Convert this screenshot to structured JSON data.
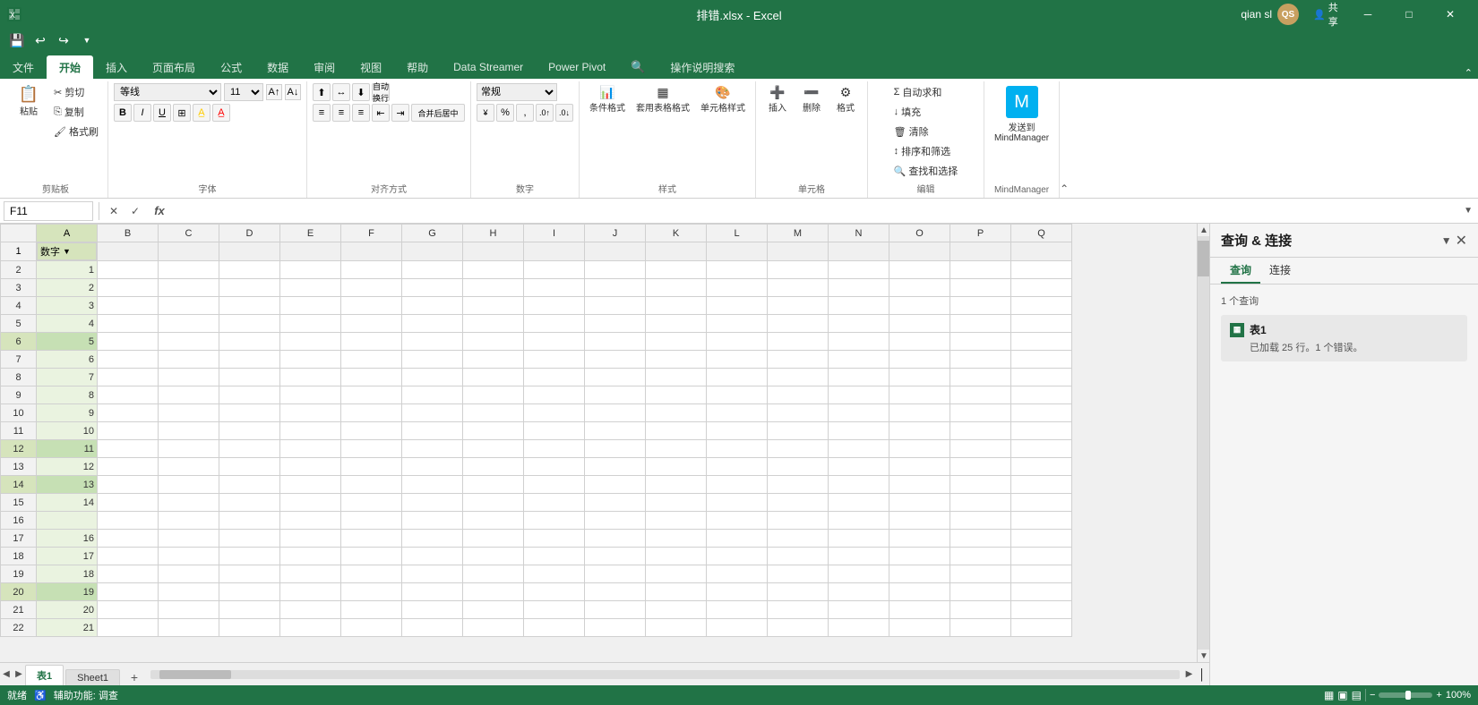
{
  "titlebar": {
    "filename": "排错.xlsx - Excel",
    "username": "qian sl",
    "avatar_text": "QS",
    "minimize": "─",
    "maximize": "□",
    "close": "✕"
  },
  "ribbon": {
    "tabs": [
      {
        "id": "file",
        "label": "文件",
        "active": false
      },
      {
        "id": "home",
        "label": "开始",
        "active": true
      },
      {
        "id": "insert",
        "label": "插入",
        "active": false
      },
      {
        "id": "layout",
        "label": "页面布局",
        "active": false
      },
      {
        "id": "formulas",
        "label": "公式",
        "active": false
      },
      {
        "id": "data",
        "label": "数据",
        "active": false
      },
      {
        "id": "review",
        "label": "审阅",
        "active": false
      },
      {
        "id": "view",
        "label": "视图",
        "active": false
      },
      {
        "id": "help",
        "label": "帮助",
        "active": false
      },
      {
        "id": "datastreamer",
        "label": "Data Streamer",
        "active": false
      },
      {
        "id": "powerpivot",
        "label": "Power Pivot",
        "active": false
      },
      {
        "id": "search_icon_tab",
        "label": "🔍",
        "active": false
      },
      {
        "id": "operations",
        "label": "操作说明搜索",
        "active": false
      }
    ],
    "groups": {
      "clipboard": {
        "label": "剪贴板",
        "paste": "粘贴",
        "cut": "剪切",
        "copy": "复制",
        "format_painter": "格式刷"
      },
      "font": {
        "label": "字体",
        "font_name": "等线",
        "font_size": "11",
        "bold": "B",
        "italic": "I",
        "underline": "U",
        "border": "田",
        "fill": "A",
        "color": "A"
      },
      "alignment": {
        "label": "对齐方式",
        "merge_center": "合并后居中"
      },
      "number": {
        "label": "数字",
        "format": "常规",
        "percent": "%",
        "comma": ",",
        "increase_decimal": ".00→",
        "decrease_decimal": "←.0"
      },
      "styles": {
        "label": "样式",
        "conditional": "条件格式",
        "table": "套用表格格式",
        "cell_styles": "单元格样式"
      },
      "cells": {
        "label": "单元格",
        "insert": "插入",
        "delete": "删除",
        "format": "格式"
      },
      "editing": {
        "label": "编辑",
        "autosum": "自动求和",
        "fill": "填充",
        "clear": "清除",
        "sort_filter": "排序和筛选",
        "find_select": "查找和选择"
      },
      "mindmanager": {
        "label": "MindManager",
        "send": "发送到\nMindManager"
      }
    }
  },
  "qat": {
    "save": "💾",
    "undo": "↩",
    "redo": "↪",
    "dropdown": "▼"
  },
  "formula_bar": {
    "cell_ref": "F11",
    "cancel": "✕",
    "confirm": "✓",
    "function": "fx"
  },
  "columns": [
    "A",
    "B",
    "C",
    "D",
    "E",
    "F",
    "G",
    "H",
    "I",
    "J",
    "K",
    "L",
    "M",
    "N",
    "O",
    "P",
    "Q"
  ],
  "header_row": {
    "row_num": "1",
    "col_a_value": "数字",
    "has_filter": true
  },
  "rows": [
    {
      "row": 2,
      "col_a": "1",
      "highlighted": false
    },
    {
      "row": 3,
      "col_a": "2",
      "highlighted": false
    },
    {
      "row": 4,
      "col_a": "3",
      "highlighted": false
    },
    {
      "row": 5,
      "col_a": "4",
      "highlighted": false
    },
    {
      "row": 6,
      "col_a": "5",
      "highlighted": true
    },
    {
      "row": 7,
      "col_a": "6",
      "highlighted": false
    },
    {
      "row": 8,
      "col_a": "7",
      "highlighted": false
    },
    {
      "row": 9,
      "col_a": "8",
      "highlighted": false
    },
    {
      "row": 10,
      "col_a": "9",
      "highlighted": false
    },
    {
      "row": 11,
      "col_a": "10",
      "highlighted": false
    },
    {
      "row": 12,
      "col_a": "11",
      "highlighted": true
    },
    {
      "row": 13,
      "col_a": "12",
      "highlighted": false
    },
    {
      "row": 14,
      "col_a": "13",
      "highlighted": true
    },
    {
      "row": 15,
      "col_a": "14",
      "highlighted": false
    },
    {
      "row": 16,
      "col_a": "",
      "highlighted": false
    },
    {
      "row": 17,
      "col_a": "16",
      "highlighted": false
    },
    {
      "row": 18,
      "col_a": "17",
      "highlighted": false
    },
    {
      "row": 19,
      "col_a": "18",
      "highlighted": false
    },
    {
      "row": 20,
      "col_a": "19",
      "highlighted": true
    },
    {
      "row": 21,
      "col_a": "20",
      "highlighted": false
    },
    {
      "row": 22,
      "col_a": "21",
      "highlighted": false
    }
  ],
  "sheet_tabs": [
    {
      "id": "tab1",
      "label": "表1",
      "active": true
    },
    {
      "id": "sheet1",
      "label": "Sheet1",
      "active": false
    }
  ],
  "status_bar": {
    "ready": "就绪",
    "accessibility": "辅助功能: 调查",
    "view_normal": "▦",
    "view_layout": "▣",
    "view_pagebreak": "▤",
    "zoom_out": "-",
    "zoom_in": "+",
    "zoom_level": "100%"
  },
  "right_panel": {
    "title": "查询 & 连接",
    "tabs": [
      {
        "id": "query",
        "label": "查询",
        "active": true
      },
      {
        "id": "connections",
        "label": "连接",
        "active": false
      }
    ],
    "query_count": "1 个查询",
    "queries": [
      {
        "name": "表1",
        "sub": "已加载 25 行。1 个错误。"
      }
    ]
  }
}
